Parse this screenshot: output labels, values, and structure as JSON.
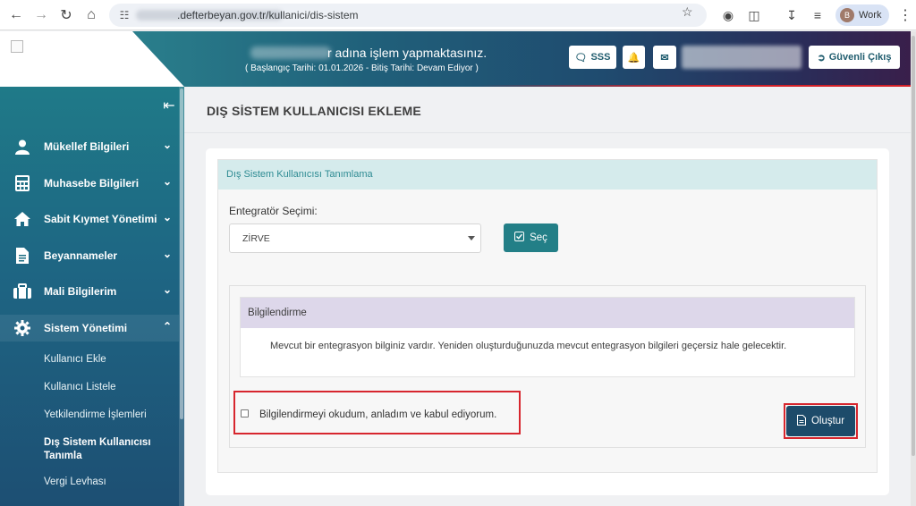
{
  "browser": {
    "url_domain": ".defterbeyan.gov.tr/kullanici/dis-sistem",
    "profile_initial": "B",
    "profile_label": "Work"
  },
  "header": {
    "title": "r adına işlem yapmaktasınız.",
    "subtitle": "( Başlangıç Tarihi: 01.01.2026 - Bitiş Tarihi: Devam Ediyor )",
    "sss_label": "SSS",
    "logout_label": "Güvenli Çıkış"
  },
  "sidebar": {
    "items": [
      {
        "label": "Mükellef Bilgileri",
        "icon": "user-icon"
      },
      {
        "label": "Muhasebe Bilgileri",
        "icon": "calculator-icon"
      },
      {
        "label": "Sabit Kıymet Yönetimi",
        "icon": "home-icon"
      },
      {
        "label": "Beyannameler",
        "icon": "document-icon"
      },
      {
        "label": "Mali Bilgilerim",
        "icon": "briefcase-icon"
      },
      {
        "label": "Sistem Yönetimi",
        "icon": "gear-icon"
      }
    ],
    "sub_items": [
      "Kullanıcı Ekle",
      "Kullanıcı Listele",
      "Yetkilendirme İşlemleri",
      "Dış Sistem Kullanıcısı Tanımla",
      "Vergi Levhası"
    ]
  },
  "main": {
    "page_title": "DIŞ SİSTEM KULLANICISI EKLEME",
    "panel_title": "Dış Sistem Kullanıcısı Tanımlama",
    "integrator_label": "Entegratör Seçimi:",
    "integrator_value": "ZİRVE",
    "select_button": "Seç",
    "info_title": "Bilgilendirme",
    "info_text": "Mevcut bir entegrasyon bilginiz vardır. Yeniden oluşturduğunuzda mevcut entegrasyon bilgileri geçersiz hale gelecektir.",
    "consent_text": "Bilgilendirmeyi okudum, anladım ve kabul ediyorum.",
    "create_button": "Oluştur"
  },
  "colors": {
    "accent": "#237f87",
    "primary_dark": "#1d4b6a",
    "highlight_red": "#d7262e",
    "info_header": "#ddd7ea",
    "panel_header": "#d5ebec"
  }
}
